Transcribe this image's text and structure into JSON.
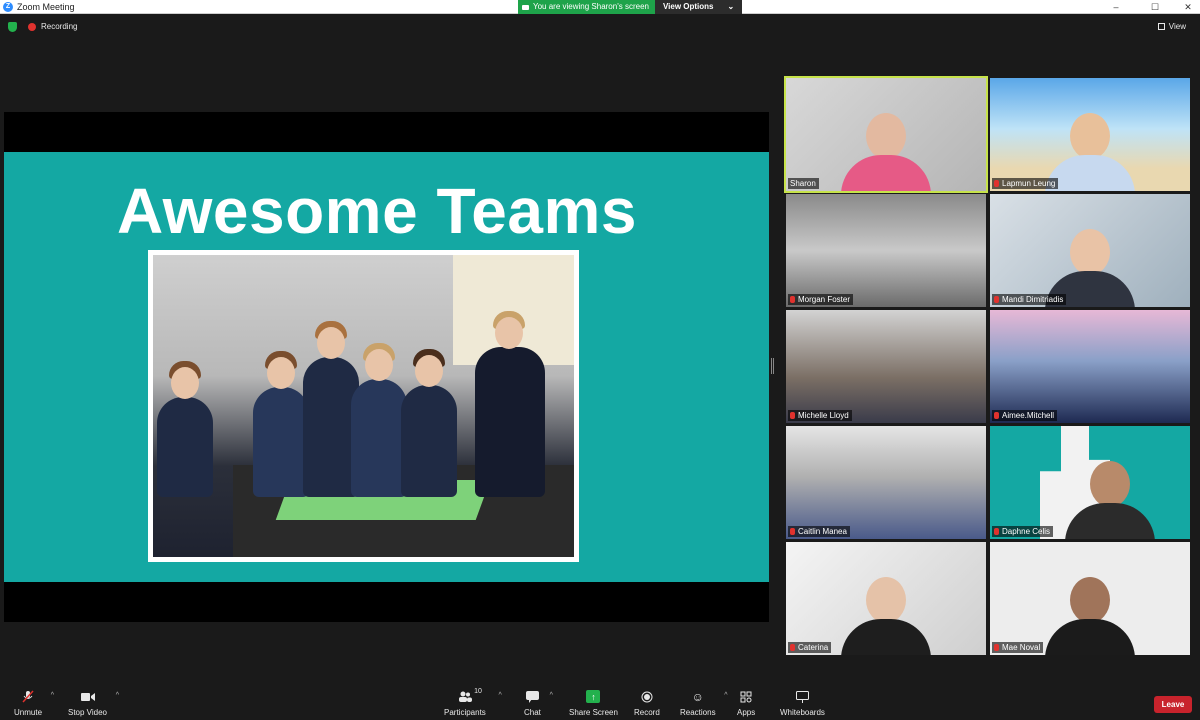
{
  "window": {
    "title": "Zoom Meeting",
    "minimize": "–",
    "maximize": "☐",
    "close": "✕"
  },
  "share_banner": {
    "viewing_text": "You are viewing Sharon's screen",
    "view_options": "View Options",
    "caret": "⌄"
  },
  "top_strip": {
    "recording_label": "Recording",
    "view_label": "View"
  },
  "slide": {
    "title": "Awesome Teams",
    "accent_color": "#14a8a3"
  },
  "gallery": [
    {
      "name": "Sharon",
      "active": true,
      "muted": false
    },
    {
      "name": "Lapmun Leung",
      "active": false,
      "muted": true
    },
    {
      "name": "Morgan Foster",
      "active": false,
      "muted": true
    },
    {
      "name": "Mandi Dimitriadis",
      "active": false,
      "muted": true
    },
    {
      "name": "Michelle Lloyd",
      "active": false,
      "muted": true
    },
    {
      "name": "Aimee.Mitchell",
      "active": false,
      "muted": true
    },
    {
      "name": "Caitlin Manea",
      "active": false,
      "muted": true
    },
    {
      "name": "Daphne Celis",
      "active": false,
      "muted": true
    },
    {
      "name": "Caterina",
      "active": false,
      "muted": true
    },
    {
      "name": "Mae Noval",
      "active": false,
      "muted": true
    }
  ],
  "toolbar": {
    "unmute": "Unmute",
    "stop_video": "Stop Video",
    "participants": "Participants",
    "participants_count": "10",
    "chat": "Chat",
    "share_screen": "Share Screen",
    "record": "Record",
    "reactions": "Reactions",
    "apps": "Apps",
    "whiteboards": "Whiteboards",
    "leave": "Leave"
  },
  "icons": {
    "mic": "microphone-off-icon",
    "video": "video-camera-icon",
    "participants": "people-icon",
    "chat": "chat-bubble-icon",
    "share": "share-arrow-icon",
    "record": "record-circle-icon",
    "reactions": "smiley-icon",
    "apps": "apps-icon",
    "whiteboards": "whiteboard-icon"
  }
}
